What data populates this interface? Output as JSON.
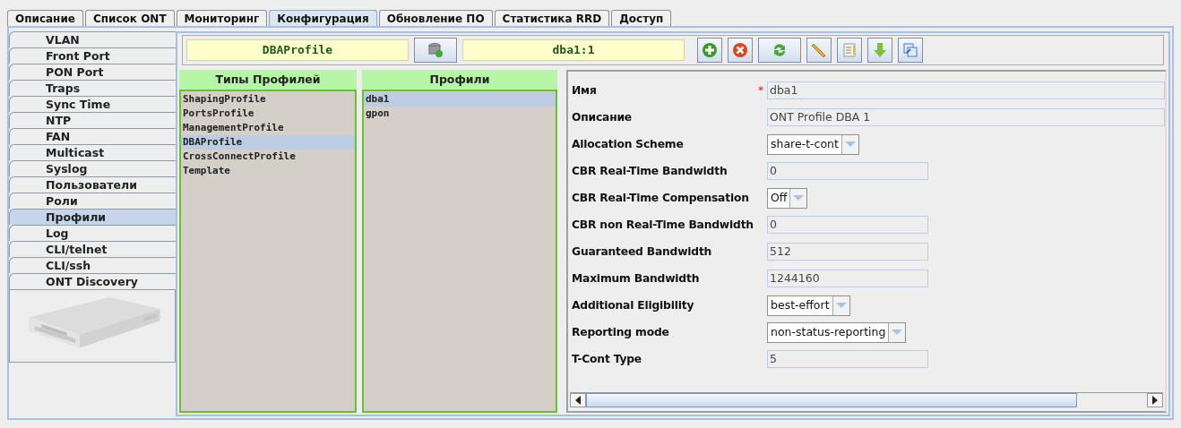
{
  "tabs": [
    {
      "label": "Описание",
      "selected": false
    },
    {
      "label": "Список ONT",
      "selected": false
    },
    {
      "label": "Мониторинг",
      "selected": false
    },
    {
      "label": "Конфигурация",
      "selected": true
    },
    {
      "label": "Обновление ПО",
      "selected": false
    },
    {
      "label": "Статистика RRD",
      "selected": false
    },
    {
      "label": "Доступ",
      "selected": false
    }
  ],
  "sidebar": {
    "items": [
      {
        "label": "VLAN",
        "selected": false
      },
      {
        "label": "Front Port",
        "selected": false
      },
      {
        "label": "PON Port",
        "selected": false
      },
      {
        "label": "Traps",
        "selected": false
      },
      {
        "label": "Sync Time",
        "selected": false
      },
      {
        "label": "NTP",
        "selected": false
      },
      {
        "label": "FAN",
        "selected": false
      },
      {
        "label": "Multicast",
        "selected": false
      },
      {
        "label": "Syslog",
        "selected": false
      },
      {
        "label": "Пользователи",
        "selected": false
      },
      {
        "label": "Роли",
        "selected": false
      },
      {
        "label": "Профили",
        "selected": true
      },
      {
        "label": "Log",
        "selected": false
      },
      {
        "label": "CLI/telnet",
        "selected": false
      },
      {
        "label": "CLI/ssh",
        "selected": false
      },
      {
        "label": "ONT Discovery",
        "selected": false
      }
    ]
  },
  "toolbar": {
    "profile_type": "DBAProfile",
    "profile_id": "dba1:1"
  },
  "profile_types": {
    "title": "Типы Профилей",
    "items": [
      {
        "label": "ShapingProfile",
        "selected": false
      },
      {
        "label": "PortsProfile",
        "selected": false
      },
      {
        "label": "ManagementProfile",
        "selected": false
      },
      {
        "label": "DBAProfile",
        "selected": true
      },
      {
        "label": "CrossConnectProfile",
        "selected": false
      },
      {
        "label": "Template",
        "selected": false
      }
    ]
  },
  "profiles": {
    "title": "Профили",
    "items": [
      {
        "label": "dba1",
        "selected": true
      },
      {
        "label": "gpon",
        "selected": false
      }
    ]
  },
  "form": {
    "required_mark": "*",
    "fields": [
      {
        "label": "Имя",
        "kind": "long-text",
        "required": true,
        "value": "dba1"
      },
      {
        "label": "Описание",
        "kind": "long-text",
        "required": false,
        "value": "ONT Profile DBA 1"
      },
      {
        "label": "Allocation Scheme",
        "kind": "select",
        "required": false,
        "value": "share-t-cont"
      },
      {
        "label": "CBR Real-Time Bandwidth",
        "kind": "text",
        "required": false,
        "value": "0"
      },
      {
        "label": "CBR Real-Time Compensation",
        "kind": "select",
        "required": false,
        "value": "Off"
      },
      {
        "label": "CBR non Real-Time Bandwidth",
        "kind": "text",
        "required": false,
        "value": "0"
      },
      {
        "label": "Guaranteed Bandwidth",
        "kind": "text",
        "required": false,
        "value": "512"
      },
      {
        "label": "Maximum Bandwidth",
        "kind": "text",
        "required": false,
        "value": "1244160"
      },
      {
        "label": "Additional Eligibility",
        "kind": "select",
        "required": false,
        "value": "best-effort"
      },
      {
        "label": "Reporting mode",
        "kind": "select",
        "required": false,
        "value": "non-status-reporting"
      },
      {
        "label": "T-Cont Type",
        "kind": "text",
        "required": false,
        "value": "5"
      }
    ]
  }
}
